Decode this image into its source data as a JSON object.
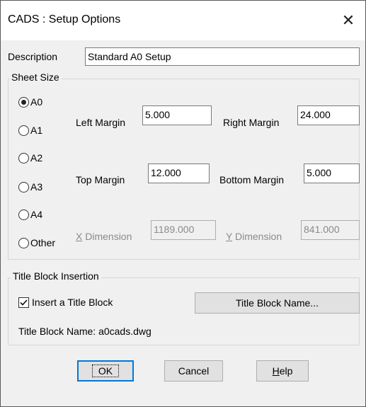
{
  "window": {
    "title": "CADS : Setup Options"
  },
  "description": {
    "label": "Description",
    "value": "Standard A0 Setup"
  },
  "sheet_size": {
    "legend": "Sheet Size",
    "options": [
      "A0",
      "A1",
      "A2",
      "A3",
      "A4",
      "Other"
    ],
    "selected": "A0",
    "left_margin": {
      "label": "Left Margin",
      "value": "5.000"
    },
    "right_margin": {
      "label": "Right Margin",
      "value": "24.000"
    },
    "top_margin": {
      "label": "Top Margin",
      "value": "12.000"
    },
    "bottom_margin": {
      "label": "Bottom Margin",
      "value": "5.000"
    },
    "x_dimension": {
      "label_mnemonic": "X",
      "label_rest": " Dimension",
      "value": "1189.000"
    },
    "y_dimension": {
      "label_mnemonic": "Y",
      "label_rest": " Dimension",
      "value": "841.000"
    }
  },
  "title_block": {
    "legend": "Title Block Insertion",
    "insert_label": "Insert a Title Block",
    "insert_checked": true,
    "name_button": "Title Block Name...",
    "name_text": "Title Block Name: a0cads.dwg"
  },
  "buttons": {
    "ok": "OK",
    "cancel": "Cancel",
    "help_mnemonic": "H",
    "help_rest": "elp"
  },
  "colors": {
    "accent": "#0078d7",
    "background": "#f0f0f0"
  },
  "icons": {
    "close": "close-icon",
    "check": "check-icon"
  }
}
